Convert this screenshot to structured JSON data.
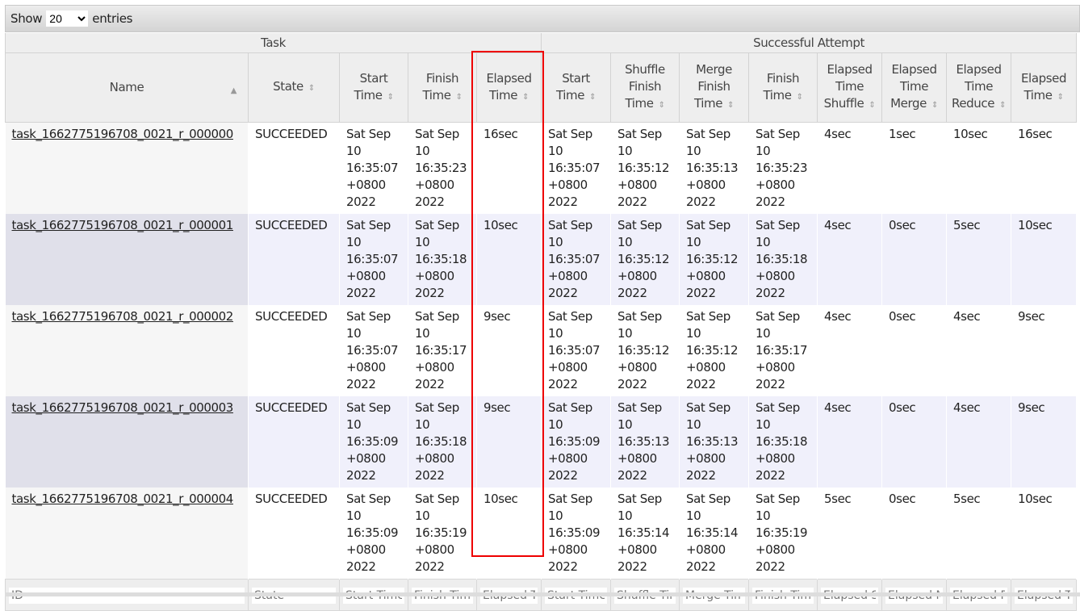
{
  "length_control": {
    "show": "Show",
    "value": "20",
    "entries": "entries"
  },
  "groups": [
    "Task",
    "Successful Attempt"
  ],
  "columns": [
    "Name",
    "State",
    "Start Time",
    "Finish Time",
    "Elapsed Time",
    "Start Time",
    "Shuffle Finish Time",
    "Merge Finish Time",
    "Finish Time",
    "Elapsed Time Shuffle",
    "Elapsed Time Merge",
    "Elapsed Time Reduce",
    "Elapsed Time"
  ],
  "sort_icons": [
    "sorted-ascending",
    "sortable",
    "sortable",
    "sortable",
    "sortable",
    "sortable",
    "sortable",
    "sortable",
    "sortable",
    "sortable",
    "sortable",
    "sortable",
    "sortable"
  ],
  "rows": [
    [
      "task_1662775196708_0021_r_000000",
      "SUCCEEDED",
      "Sat Sep 10 16:35:07 +0800 2022",
      "Sat Sep 10 16:35:23 +0800 2022",
      "16sec",
      "Sat Sep 10 16:35:07 +0800 2022",
      "Sat Sep 10 16:35:12 +0800 2022",
      "Sat Sep 10 16:35:13 +0800 2022",
      "Sat Sep 10 16:35:23 +0800 2022",
      "4sec",
      "1sec",
      "10sec",
      "16sec"
    ],
    [
      "task_1662775196708_0021_r_000001",
      "SUCCEEDED",
      "Sat Sep 10 16:35:07 +0800 2022",
      "Sat Sep 10 16:35:18 +0800 2022",
      "10sec",
      "Sat Sep 10 16:35:07 +0800 2022",
      "Sat Sep 10 16:35:12 +0800 2022",
      "Sat Sep 10 16:35:12 +0800 2022",
      "Sat Sep 10 16:35:18 +0800 2022",
      "4sec",
      "0sec",
      "5sec",
      "10sec"
    ],
    [
      "task_1662775196708_0021_r_000002",
      "SUCCEEDED",
      "Sat Sep 10 16:35:07 +0800 2022",
      "Sat Sep 10 16:35:17 +0800 2022",
      "9sec",
      "Sat Sep 10 16:35:07 +0800 2022",
      "Sat Sep 10 16:35:12 +0800 2022",
      "Sat Sep 10 16:35:12 +0800 2022",
      "Sat Sep 10 16:35:17 +0800 2022",
      "4sec",
      "0sec",
      "4sec",
      "9sec"
    ],
    [
      "task_1662775196708_0021_r_000003",
      "SUCCEEDED",
      "Sat Sep 10 16:35:09 +0800 2022",
      "Sat Sep 10 16:35:18 +0800 2022",
      "9sec",
      "Sat Sep 10 16:35:09 +0800 2022",
      "Sat Sep 10 16:35:13 +0800 2022",
      "Sat Sep 10 16:35:13 +0800 2022",
      "Sat Sep 10 16:35:18 +0800 2022",
      "4sec",
      "0sec",
      "4sec",
      "9sec"
    ],
    [
      "task_1662775196708_0021_r_000004",
      "SUCCEEDED",
      "Sat Sep 10 16:35:09 +0800 2022",
      "Sat Sep 10 16:35:19 +0800 2022",
      "10sec",
      "Sat Sep 10 16:35:09 +0800 2022",
      "Sat Sep 10 16:35:14 +0800 2022",
      "Sat Sep 10 16:35:14 +0800 2022",
      "Sat Sep 10 16:35:19 +0800 2022",
      "5sec",
      "0sec",
      "5sec",
      "10sec"
    ]
  ],
  "filters": [
    "ID",
    "State",
    "Start Time",
    "Finish Time",
    "Elapsed Time",
    "Start Time",
    "Shuffle Time",
    "Merge Time",
    "Finish Time",
    "Elapsed Shuffle Time",
    "Elapsed Merge Time",
    "Elapsed Reduce Time",
    "Elapsed Time"
  ],
  "highlight_color": "#e00000"
}
